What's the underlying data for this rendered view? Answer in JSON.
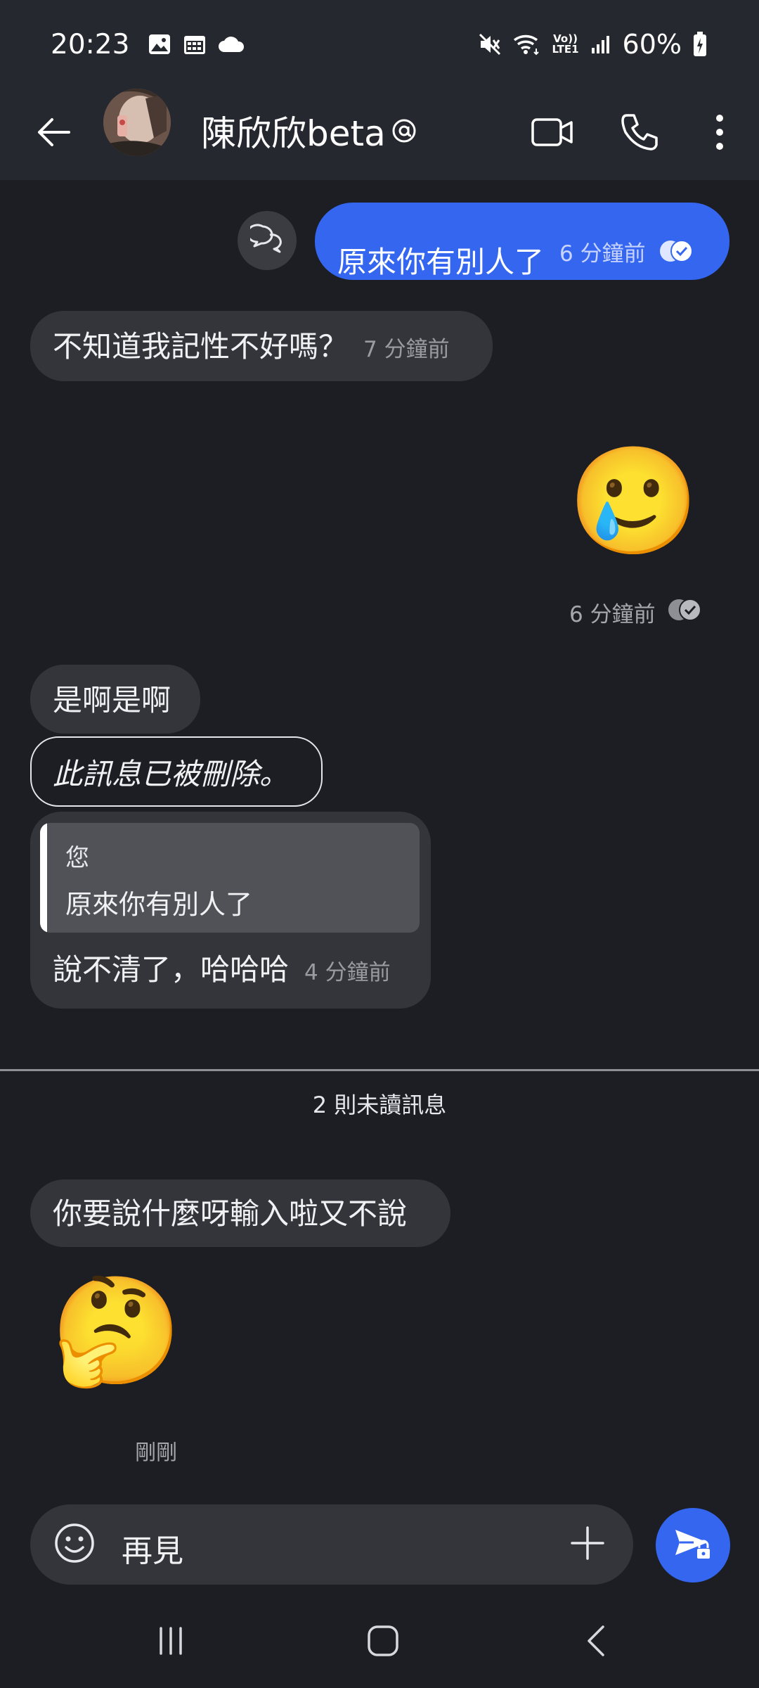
{
  "status_bar": {
    "time": "20:23",
    "battery": "60%",
    "network": "Vo)) LTE1",
    "icons": [
      "gallery-icon",
      "calendar-icon",
      "cloud-icon",
      "mute-icon",
      "wifi-icon",
      "signal-icon",
      "battery-charging-icon"
    ]
  },
  "header": {
    "contact_name": "陳欣欣beta",
    "icons": [
      "back-arrow-icon",
      "video-call-icon",
      "phone-icon",
      "more-vert-icon",
      "at-sign-icon"
    ]
  },
  "messages": [
    {
      "id": "m1",
      "direction": "out",
      "text": "原來你有別人了",
      "time": "6 分鐘前",
      "read": true
    },
    {
      "id": "m2",
      "direction": "in",
      "text": "不知道我記性不好嗎？",
      "time": "7 分鐘前"
    },
    {
      "id": "m3",
      "direction": "out",
      "emoji": "🥲",
      "time": "6 分鐘前",
      "read": true
    },
    {
      "id": "m4",
      "direction": "in",
      "text": "是啊是啊"
    },
    {
      "id": "m5",
      "direction": "in",
      "deleted_text": "此訊息已被刪除。"
    },
    {
      "id": "m6",
      "direction": "in",
      "quote_author": "您",
      "quote_text": "原來你有別人了",
      "text": "說不清了，哈哈哈",
      "time": "4 分鐘前"
    },
    {
      "id": "m7",
      "direction": "in",
      "text": "你要說什麼呀輸入啦又不說"
    },
    {
      "id": "m8",
      "direction": "in",
      "emoji": "🤔",
      "time": "剛剛"
    }
  ],
  "unread_divider": "2 則未讀訊息",
  "composer": {
    "input_value": "再見",
    "icons": [
      "emoji-icon",
      "plus-icon",
      "send-lock-icon"
    ]
  },
  "nav_bar": {
    "icons": [
      "recents-icon",
      "home-icon",
      "back-icon"
    ]
  },
  "colors": {
    "background": "#1d1e23",
    "header_bg": "#26282f",
    "outgoing_bubble": "#3466f0",
    "incoming_bubble": "#33353b",
    "accent": "#3466f0"
  }
}
